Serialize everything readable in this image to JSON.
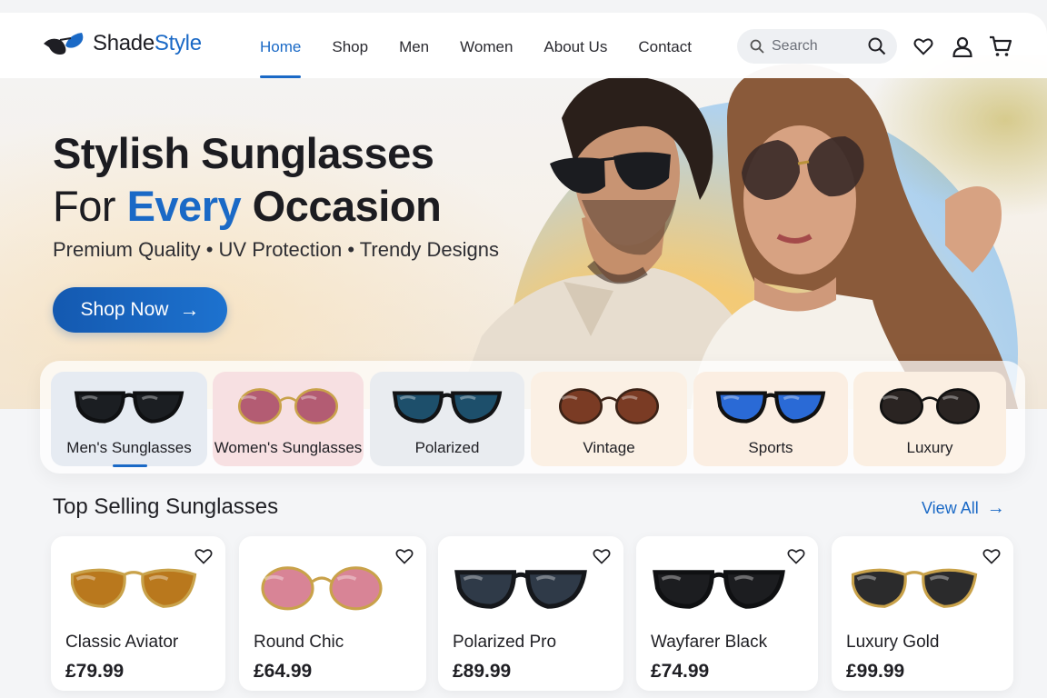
{
  "brand": {
    "name_part1": "Shade",
    "name_part2": "Style"
  },
  "nav": {
    "links": [
      "Home",
      "Shop",
      "Men",
      "Women",
      "About Us",
      "Contact"
    ],
    "active": "Home",
    "search_placeholder": "Search"
  },
  "hero": {
    "title_line1": "Stylish Sunglasses",
    "title_line2_pre": "For ",
    "title_line2_accent": "Every",
    "title_line2_post": " Occasion",
    "subtitle": "Premium Quality • UV Protection • Trendy Designs",
    "cta_label": "Shop Now",
    "cta_arrow": "→"
  },
  "categories": [
    {
      "label": "Men's Sunglasses",
      "bg": "#e6ebf2",
      "lens": "#1b1e22"
    },
    {
      "label": "Women's Sunglasses",
      "bg": "#f7e0e2",
      "lens": "#b35c73"
    },
    {
      "label": "Polarized",
      "bg": "#e9ecf0",
      "lens": "#1d4f6b"
    },
    {
      "label": "Vintage",
      "bg": "#fbf0e4",
      "lens": "#7a3b24"
    },
    {
      "label": "Sports",
      "bg": "#fbeee2",
      "lens": "#2a6ad6"
    },
    {
      "label": "Luxury",
      "bg": "#fbefe2",
      "lens": "#2a2422"
    }
  ],
  "active_category": "Men's Sunglasses",
  "top_selling": {
    "title": "Top Selling Sunglasses",
    "view_all": "View All",
    "products": [
      {
        "name": "Classic Aviator",
        "price": "£79.99",
        "lens": "#b9781d",
        "frame": "#c9a24a"
      },
      {
        "name": "Round Chic",
        "price": "£64.99",
        "lens": "#d88496",
        "frame": "#c9a24a"
      },
      {
        "name": "Polarized Pro",
        "price": "£89.99",
        "lens": "#2f3a48",
        "frame": "#15171b"
      },
      {
        "name": "Wayfarer Black",
        "price": "£74.99",
        "lens": "#1c1d20",
        "frame": "#0f1012"
      },
      {
        "name": "Luxury Gold",
        "price": "£99.99",
        "lens": "#2b2b2c",
        "frame": "#c9a24a"
      }
    ]
  },
  "colors": {
    "accent": "#1a69c6",
    "text": "#1d1d22"
  }
}
